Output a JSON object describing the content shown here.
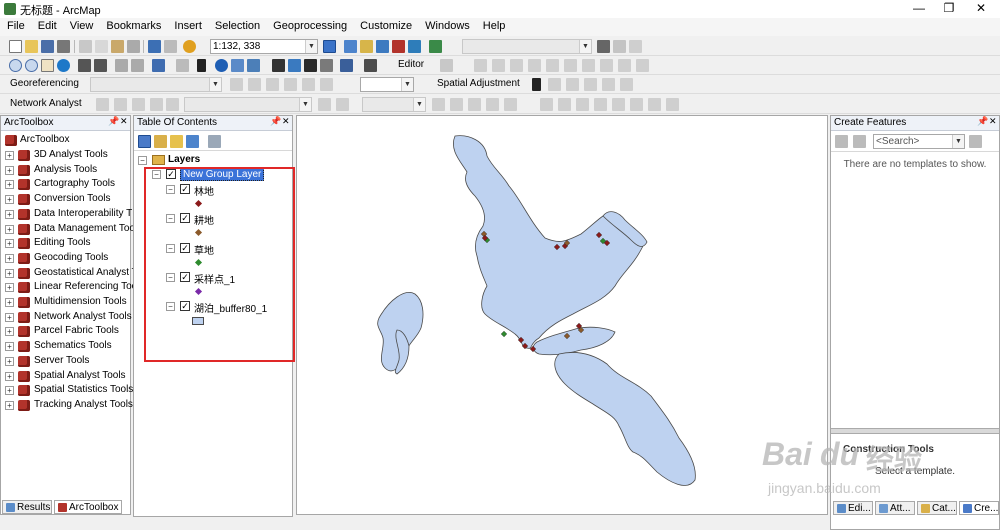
{
  "window": {
    "title": "无标题 - ArcMap",
    "minimize": "—",
    "restore": "❐",
    "close": "✕"
  },
  "menubar": [
    "File",
    "Edit",
    "View",
    "Bookmarks",
    "Insert",
    "Selection",
    "Geoprocessing",
    "Customize",
    "Windows",
    "Help"
  ],
  "toolbar": {
    "scale_value": "1:132, 338",
    "editor_label": "Editor",
    "georeferencing_label": "Georeferencing",
    "spatial_adjustment_label": "Spatial Adjustment",
    "network_analyst_label": "Network Analyst"
  },
  "arctoolbox": {
    "title": "ArcToolbox",
    "root": "ArcToolbox",
    "items": [
      "3D Analyst Tools",
      "Analysis Tools",
      "Cartography Tools",
      "Conversion Tools",
      "Data Interoperability T",
      "Data Management Too",
      "Editing Tools",
      "Geocoding Tools",
      "Geostatistical Analyst T",
      "Linear Referencing Too",
      "Multidimension Tools",
      "Network Analyst Tools",
      "Parcel Fabric Tools",
      "Schematics Tools",
      "Server Tools",
      "Spatial Analyst Tools",
      "Spatial Statistics Tools",
      "Tracking Analyst Tools"
    ],
    "tabs": [
      "Results",
      "ArcToolbox"
    ]
  },
  "toc": {
    "title": "Table Of Contents",
    "root": "Layers",
    "group": "New Group Layer",
    "layers": [
      {
        "name": "林地",
        "symbol_color": "#8b1a1a"
      },
      {
        "name": "耕地",
        "symbol_color": "#8b5a2b"
      },
      {
        "name": "草地",
        "symbol_color": "#2e8b2e"
      },
      {
        "name": "采样点_1",
        "symbol_color": "#7a2aa8"
      },
      {
        "name": "湖泊_buffer80_1",
        "symbol_color": "#bed2f0"
      }
    ],
    "check_mark": "✓",
    "highlight_color": "#e02828"
  },
  "create_features": {
    "title": "Create Features",
    "search_placeholder": "<Search>",
    "empty_message": "There are no templates to show.",
    "construction_title": "Construction Tools",
    "construction_hint": "Select a template.",
    "tabs": [
      "Edi...",
      "Att...",
      "Cat...",
      "Cre..."
    ]
  },
  "map": {
    "lake_color": "#bed2f0",
    "outline_color": "#4a4a4a"
  },
  "watermark": {
    "brand": "Bai",
    "brand2": "du",
    "cn": "经验",
    "url": "jingyan.baidu.com"
  }
}
